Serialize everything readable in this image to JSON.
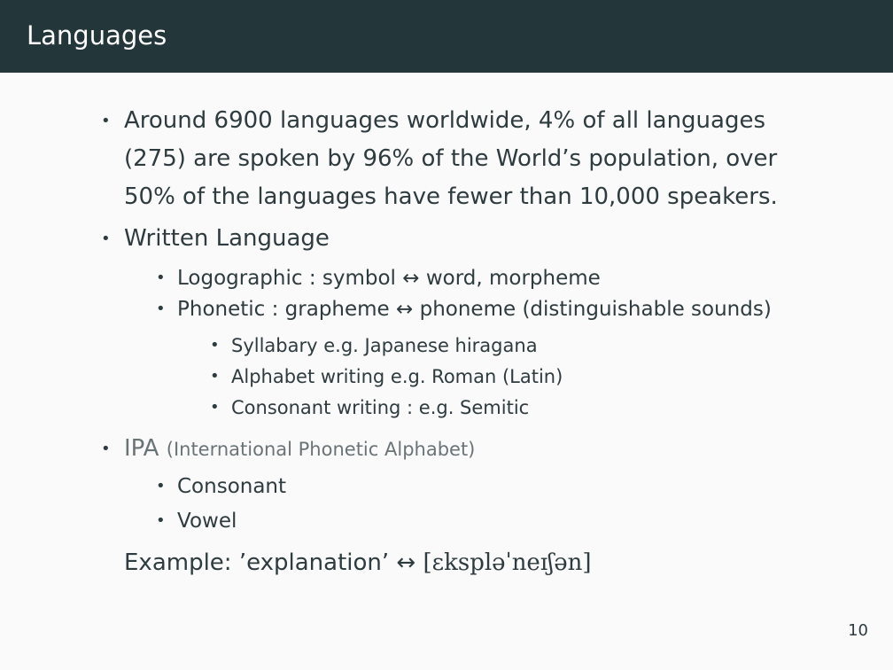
{
  "header": {
    "title": "Languages"
  },
  "bullets": {
    "b1_line1": "Around 6900 languages worldwide, 4% of all languages",
    "b1_line2": "(275) are spoken by 96% of the World’s population, over",
    "b1_line3": "50% of the languages have fewer than 10,000 speakers.",
    "b2": "Written Language",
    "b2_sub1": "Logographic : symbol ↔ word, morpheme",
    "b2_sub2": "Phonetic : grapheme ↔ phoneme (distinguishable sounds)",
    "b2_sub2_a": "Syllabary e.g. Japanese hiragana",
    "b2_sub2_b": "Alphabet writing e.g. Roman (Latin)",
    "b2_sub2_c": "Consonant writing : e.g. Semitic",
    "b3": "IPA",
    "b3_note": "(International Phonetic Alphabet)",
    "b3_sub1": "Consonant",
    "b3_sub2": "Vowel",
    "example_prefix": "Example: ’explanation’",
    "example_arrow": "↔",
    "example_ipa": "[ɛkspləˈneɪʃən]"
  },
  "footer": {
    "page_number": "10"
  }
}
